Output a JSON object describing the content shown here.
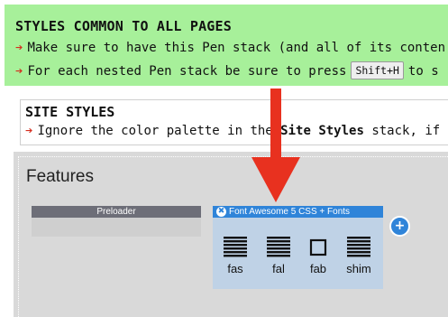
{
  "common": {
    "title": "STYLES COMMON TO ALL PAGES",
    "line1": "Make sure to have this Pen stack (and all of its conten",
    "line2_before": "For each nested Pen stack be sure to press",
    "line2_key": "Shift+H",
    "line2_after": "to s"
  },
  "site_styles": {
    "title": "SITE STYLES",
    "line_before": "Ignore the color palette in the",
    "line_bold": "Site Styles",
    "line_after": "stack, if"
  },
  "features": {
    "title": "Features",
    "preloader_label": "Preloader",
    "fa_label": "Font Awesome 5 CSS + Fonts",
    "close_symbol": "✖",
    "add_symbol": "+",
    "icons": [
      {
        "label": "fas",
        "icon": "bars-icon"
      },
      {
        "label": "fal",
        "icon": "bars-icon"
      },
      {
        "label": "fab",
        "icon": "square-outline-icon"
      },
      {
        "label": "shim",
        "icon": "bars-icon"
      }
    ]
  },
  "colors": {
    "banner_bg": "#a7f09a",
    "arrow_red": "#e8311f",
    "fa_blue": "#2f84d9"
  }
}
